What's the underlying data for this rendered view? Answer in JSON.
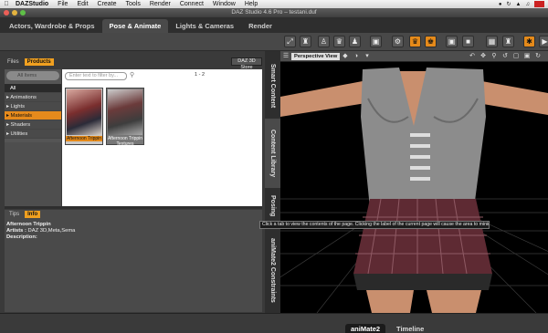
{
  "menubar": {
    "items": [
      "DAZStudio",
      "File",
      "Edit",
      "Create",
      "Tools",
      "Render",
      "Connect",
      "Window",
      "Help"
    ]
  },
  "window": {
    "title": "DAZ Studio 4.6 Pro – testani.duf"
  },
  "rooms": [
    "Actors, Wardrobe & Props",
    "Pose & Animate",
    "Lights & Cameras",
    "Render"
  ],
  "content_library": {
    "tabs": [
      "Files",
      "Products"
    ],
    "store_button": "DAZ 3D Store",
    "category_dropdown": "All Items",
    "categories": [
      "All",
      "Animations",
      "Lights",
      "Materials",
      "Shaders",
      "Utilities"
    ],
    "filter_placeholder": "Enter text to filter by...",
    "page_count": "1 - 2",
    "products": [
      {
        "name": "Afternoon Trippin"
      },
      {
        "name": "Afternoon Trippin Textures"
      }
    ]
  },
  "info_panel": {
    "tabs": [
      "Tips",
      "Info"
    ],
    "title": "Afternoon Trippin",
    "artists_label": "Artists :",
    "artists_value": "DAZ 3D,Meta,Sema",
    "description_label": "Description:"
  },
  "side_tabs": [
    "Smart Content",
    "Content Library",
    "Posing",
    "aniMate2 Constraints"
  ],
  "tooltip": "Click a tab to view the contents of the page. Clicking the label of the current page will cause the area to minimize.",
  "viewport": {
    "label": "Perspective View"
  },
  "bottom_tabs": [
    "aniMate2",
    "Timeline"
  ],
  "colors": {
    "accent": "#e58a1a",
    "bg": "#3a3a3a"
  }
}
